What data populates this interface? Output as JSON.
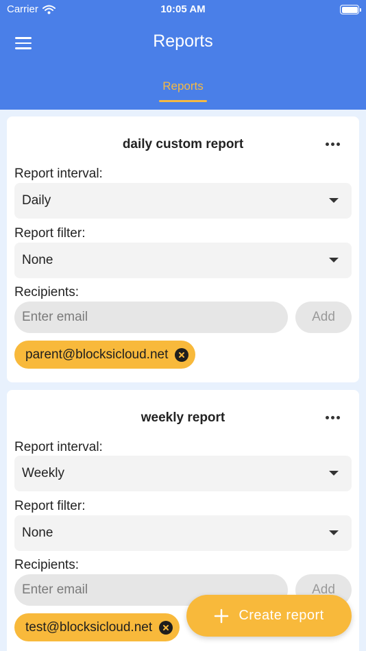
{
  "status_bar": {
    "carrier": "Carrier",
    "time": "10:05 AM",
    "wifi_icon": "wifi-icon",
    "battery_icon": "battery-icon"
  },
  "header": {
    "title": "Reports",
    "menu_icon": "hamburger-menu-icon"
  },
  "tabs": [
    {
      "label": "Reports",
      "active": true
    }
  ],
  "reports": [
    {
      "title": "daily custom report",
      "interval_label": "Report interval:",
      "interval_value": "Daily",
      "filter_label": "Report filter:",
      "filter_value": "None",
      "recipients_label": "Recipients:",
      "email_placeholder": "Enter email",
      "add_label": "Add",
      "recipients": [
        "parent@blocksicloud.net"
      ]
    },
    {
      "title": "weekly report",
      "interval_label": "Report interval:",
      "interval_value": "Weekly",
      "filter_label": "Report filter:",
      "filter_value": "None",
      "recipients_label": "Recipients:",
      "email_placeholder": "Enter email",
      "add_label": "Add",
      "recipients": [
        "test@blocksicloud.net"
      ]
    }
  ],
  "fab": {
    "label": "Create report",
    "icon": "plus-icon"
  },
  "colors": {
    "header": "#4a7fe8",
    "accent": "#f8b93b",
    "background": "#e8f1fd"
  }
}
